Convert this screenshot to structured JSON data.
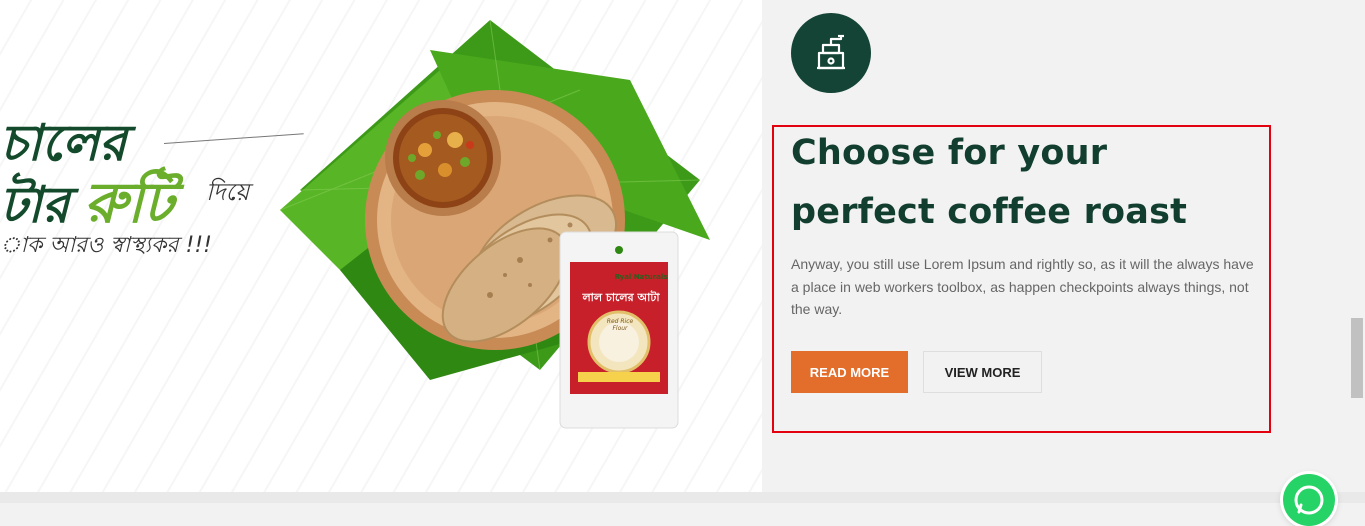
{
  "banner": {
    "line1": "চালের",
    "line2_a": "টার",
    "line2_b": "রুটি",
    "line2_c": "দিয়ে",
    "line3": "াক আরও স্বাস্থ্যকর !!!",
    "product": {
      "brand": "Ryal Naturals",
      "name": "লাল চালের আটা",
      "badge": "Red Rice Flour"
    }
  },
  "feature": {
    "icon": "coffee-grinder-icon",
    "heading": "Choose for your perfect coffee roast",
    "body": "Anyway, you still use Lorem Ipsum and rightly so, as it will the always have a place in web workers toolbox, as happen checkpoints always things, not the way.",
    "primary_button": "READ MORE",
    "secondary_button": "VIEW MORE"
  },
  "colors": {
    "accent_orange": "#e36d2b",
    "brand_green_dark": "#123e30",
    "highlight_red": "#e3000f",
    "whatsapp": "#25d366"
  },
  "floating": {
    "whatsapp_icon": "whatsapp-icon"
  }
}
